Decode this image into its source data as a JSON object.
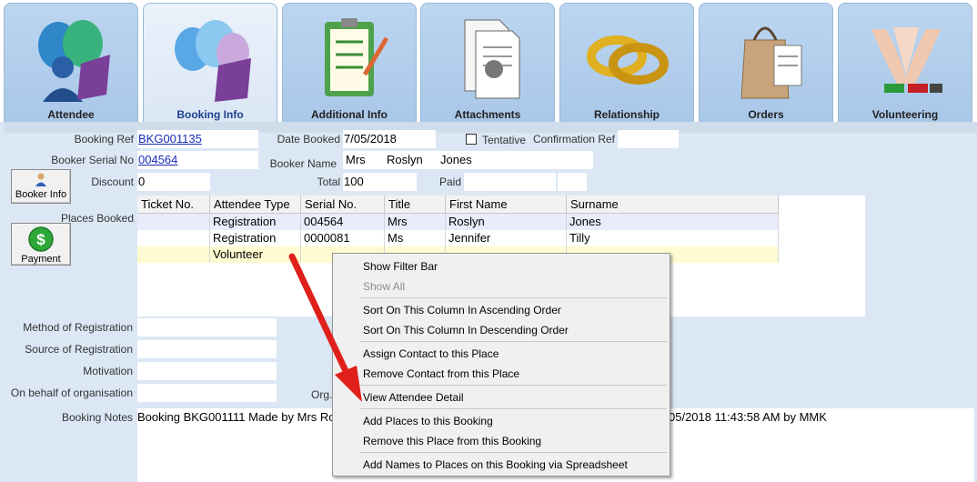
{
  "tabs": [
    {
      "label": "Attendee",
      "icon": "attendee-balloons-icon",
      "active": false
    },
    {
      "label": "Booking Info",
      "icon": "booking-balloons-icon",
      "active": true
    },
    {
      "label": "Additional Info",
      "icon": "clipboard-checklist-icon",
      "active": false
    },
    {
      "label": "Attachments",
      "icon": "paperclip-documents-icon",
      "active": false
    },
    {
      "label": "Relationship",
      "icon": "wedding-rings-icon",
      "active": false
    },
    {
      "label": "Orders",
      "icon": "shopping-bag-icon",
      "active": false
    },
    {
      "label": "Volunteering",
      "icon": "raised-hands-icon",
      "active": false
    }
  ],
  "form": {
    "booking_ref_label": "Booking Ref",
    "booking_ref": "BKG001135",
    "date_booked_label": "Date Booked",
    "date_booked": "7/05/2018",
    "tentative_label": "Tentative",
    "confirmation_ref_label": "Confirmation Ref",
    "confirmation_ref": "",
    "booker_serial_label": "Booker Serial No",
    "booker_serial": "004564",
    "booker_name_label": "Booker Name",
    "booker_title": "Mrs",
    "booker_first": "Roslyn",
    "booker_last": "Jones",
    "discount_label": "Discount",
    "discount": "0",
    "total_label": "Total",
    "total": "100",
    "paid_label": "Paid",
    "paid": "",
    "places_booked_label": "Places Booked",
    "method_label": "Method of Registration",
    "source_label": "Source of Registration",
    "motivation_label": "Motivation",
    "on_behalf_label": "On behalf of organisation",
    "org_label": "Org.",
    "notes_label": "Booking Notes",
    "notes_left": "Booking BKG001111 Made by Mrs Ro",
    "notes_right": "05/2018 11:43:58 AM by MMK"
  },
  "buttons": {
    "booker_info": "Booker Info",
    "payment": "Payment"
  },
  "grid": {
    "columns": [
      "Ticket No.",
      "Attendee Type",
      "Serial No.",
      "Title",
      "First Name",
      "Surname"
    ],
    "rows": [
      [
        "",
        "Registration",
        "004564",
        "Mrs",
        "Roslyn",
        "Jones"
      ],
      [
        "",
        "Registration",
        "0000081",
        "Ms",
        "Jennifer",
        "Tilly"
      ],
      [
        "",
        "Volunteer",
        "",
        "",
        "",
        ""
      ]
    ]
  },
  "context_menu": {
    "items": [
      {
        "label": "Show Filter Bar",
        "disabled": false
      },
      {
        "label": "Show All",
        "disabled": true
      },
      {
        "label": "Sort On This Column In Ascending Order",
        "disabled": false
      },
      {
        "label": "Sort On This Column In Descending Order",
        "disabled": false
      },
      {
        "label": "Assign Contact to this Place",
        "disabled": false
      },
      {
        "label": "Remove Contact from this Place",
        "disabled": false
      },
      {
        "label": "View Attendee Detail",
        "disabled": false
      },
      {
        "label": "Add Places to this Booking",
        "disabled": false
      },
      {
        "label": "Remove this Place from this Booking",
        "disabled": false
      },
      {
        "label": "Add Names to Places on this Booking via Spreadsheet",
        "disabled": false
      }
    ]
  },
  "colors": {
    "annotation_arrow": "#e0201a",
    "active_tab_label": "#1b3f8f",
    "selected_row": "#e8ecfb",
    "volunteer_row": "#fffbd0"
  }
}
